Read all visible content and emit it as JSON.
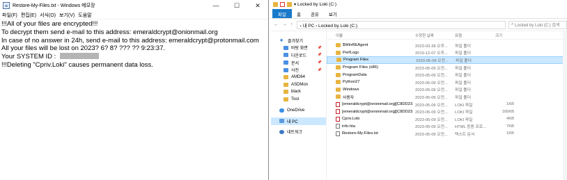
{
  "notepad": {
    "title": "Restore-My-Files.txt - Windows 메모장",
    "window_buttons": [
      "—",
      "☐",
      "✕"
    ],
    "menu": [
      "파일(F)",
      "편집(E)",
      "서식(O)",
      "보기(V)",
      "도움말"
    ],
    "lines": [
      "!!!All of your files are encrypted!!!",
      "To decrypt them send e-mail to this address: emeraldcrypt@onionmail.org",
      "In case of no answer in 24h, send e-mail to this address: emeraldcrypt@protonmail.com",
      "All your files will be lost on 2023? 6? 8? ??? ?? 9:23:37.",
      "Your SYSTEM ID : ",
      "!!!Deleting \"Cpriv.Loki\" causes permanent data loss."
    ]
  },
  "explorer": {
    "title": "Locked by Loki (C:)",
    "ribbon_tabs": [
      "파일",
      "홈",
      "공유",
      "보기"
    ],
    "address": {
      "nav": [
        "←",
        "→",
        "↑"
      ],
      "path": "› 내 PC  ›  Locked by Loki (C:)",
      "search_placeholder": "Locked by Loki (C:) 검색"
    },
    "nav_pane": [
      {
        "label": "즐겨찾기",
        "icon": "star-icon"
      },
      {
        "label": "바탕 화면",
        "icon": "desktop-icon",
        "sub": true,
        "pinned": true
      },
      {
        "label": "다운로드",
        "icon": "download-icon",
        "sub": true,
        "pinned": true
      },
      {
        "label": "문서",
        "icon": "documents-icon",
        "sub": true,
        "pinned": true
      },
      {
        "label": "사진",
        "icon": "pictures-icon",
        "sub": true,
        "pinned": true
      },
      {
        "label": "AMD64",
        "icon": "folder-icon",
        "sub": true
      },
      {
        "label": "ASDMon",
        "icon": "folder-icon",
        "sub": true
      },
      {
        "label": "black",
        "icon": "folder-icon",
        "sub": true
      },
      {
        "label": "Tool",
        "icon": "folder-icon",
        "sub": true
      },
      {
        "label": "OneDrive",
        "icon": "onedrive-icon",
        "gap": true
      },
      {
        "label": "내 PC",
        "icon": "pc-icon",
        "selected": true,
        "gap": true
      },
      {
        "label": "네트워크",
        "icon": "network-icon",
        "gap": true
      }
    ],
    "columns": {
      "name": "이름",
      "date": "수정한 날짜",
      "type": "유형",
      "size": "크기"
    },
    "files": [
      {
        "name": "$WinREAgent",
        "date": "2023-03-28 오후...",
        "type": "파일 폴더",
        "size": "",
        "icon": "folder"
      },
      {
        "name": "PerfLogs",
        "date": "2019-12-07 오후...",
        "type": "파일 폴더",
        "size": "",
        "icon": "folder"
      },
      {
        "name": "Program Files",
        "date": "2023-05-09 오전...",
        "type": "파일 폴더",
        "size": "",
        "icon": "folder",
        "selected": true
      },
      {
        "name": "Program Files (x86)",
        "date": "2023-05-09 오전...",
        "type": "파일 폴더",
        "size": "",
        "icon": "folder"
      },
      {
        "name": "ProgramData",
        "date": "2023-05-09 오전...",
        "type": "파일 폴더",
        "size": "",
        "icon": "folder"
      },
      {
        "name": "Python27",
        "date": "2023-05-09 오전...",
        "type": "파일 폴더",
        "size": "",
        "icon": "folder"
      },
      {
        "name": "Windows",
        "date": "2023-05-09 오전...",
        "type": "파일 폴더",
        "size": "",
        "icon": "folder"
      },
      {
        "name": "사용자",
        "date": "2023-05-09 오전...",
        "type": "파일 폴더",
        "size": "",
        "icon": "folder"
      },
      {
        "name": "[emeraldcrypt@onionmail.org][C8DD23...",
        "date": "2023-05-09 오전...",
        "type": "LOKI 파일",
        "size": "1KB",
        "icon": "loki"
      },
      {
        "name": "[emeraldcrypt@onionmail.org][C8DD23...",
        "date": "2023-05-09 오전...",
        "type": "LOKI 파일",
        "size": "165KB",
        "icon": "loki"
      },
      {
        "name": "Cpriv.Loki",
        "date": "2023-05-09 오전...",
        "type": "LOKI 파일",
        "size": "4KB",
        "icon": "loki"
      },
      {
        "name": "info.hta",
        "date": "2023-05-09 오전...",
        "type": "HTML 응용 프로...",
        "size": "7KB",
        "icon": "hta"
      },
      {
        "name": "Restore-My-Files.txt",
        "date": "2023-05-09 오전...",
        "type": "텍스트 문서",
        "size": "1KB",
        "icon": "txt"
      }
    ]
  }
}
